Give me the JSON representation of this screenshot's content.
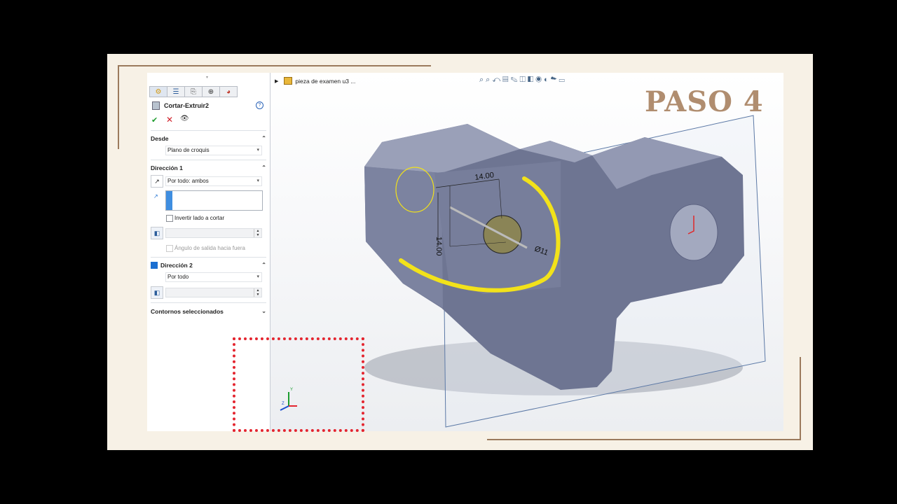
{
  "slide": {
    "heading": "PASO 4"
  },
  "feature_manager": {
    "feature_title": "Cortar-Extruir2",
    "help_icon": "?",
    "sections": {
      "desde": {
        "title": "Desde",
        "value": "Plano de croquis"
      },
      "direccion1": {
        "title": "Dirección 1",
        "end_condition": "Por todo: ambos",
        "depth_value": "",
        "flip_label": "Invertir lado a cortar",
        "draft_label": "Ángulo de salida hacia fuera"
      },
      "direccion2": {
        "title": "Dirección 2",
        "checked": true,
        "end_condition": "Por todo"
      },
      "contornos": {
        "title": "Contornos seleccionados"
      }
    }
  },
  "viewport": {
    "tree_label": "pieza de examen u3 ...",
    "dimensions": {
      "horizontal": "14.00",
      "vertical": "14.00",
      "diameter": "Ø11"
    },
    "triad": {
      "y": "Y",
      "z": "Z"
    }
  },
  "colors": {
    "accent_title": "#b08d6f",
    "highlight_red": "#e4252f",
    "annotation_yellow": "#f2e21a",
    "model_body": "#6e7592"
  }
}
